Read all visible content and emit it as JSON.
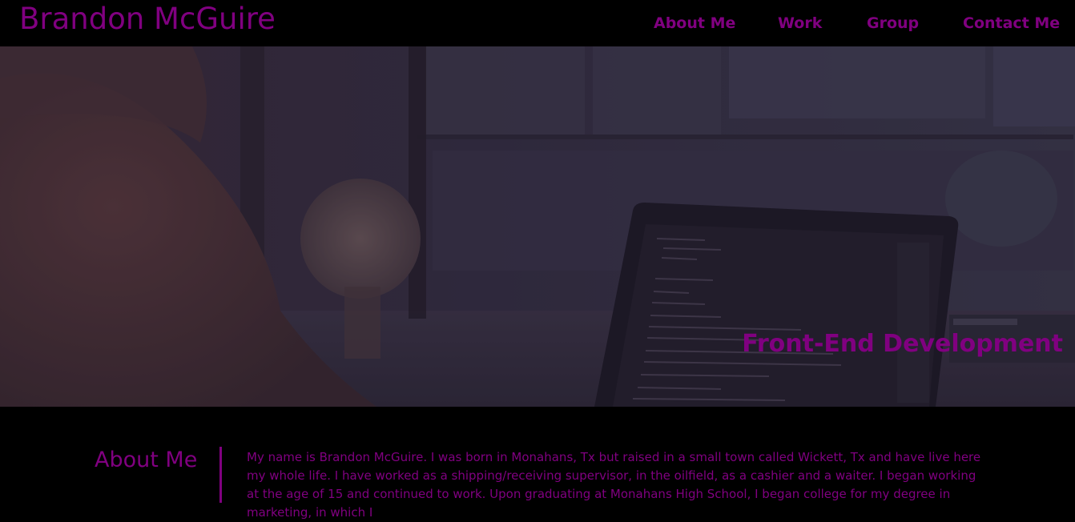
{
  "header": {
    "site_title": "Brandon McGuire",
    "nav": [
      {
        "label": "About Me"
      },
      {
        "label": "Work"
      },
      {
        "label": "Group"
      },
      {
        "label": "Contact Me"
      }
    ]
  },
  "hero": {
    "tagline": "Front-End Development"
  },
  "about": {
    "heading": "About Me",
    "body": "My name is Brandon McGuire. I was born in Monahans, Tx but raised in a small town called Wickett, Tx and have live here my whole life. I have worked as a shipping/receiving supervisor, in the oilfield, as a cashier and a waiter. I began working at the age of 15 and continued to work. Upon graduating at Monahans High School, I began college for my degree in marketing, in which I"
  },
  "colors": {
    "accent": "#800080",
    "background": "#000000",
    "hero_tint": "#2e2a3a"
  }
}
